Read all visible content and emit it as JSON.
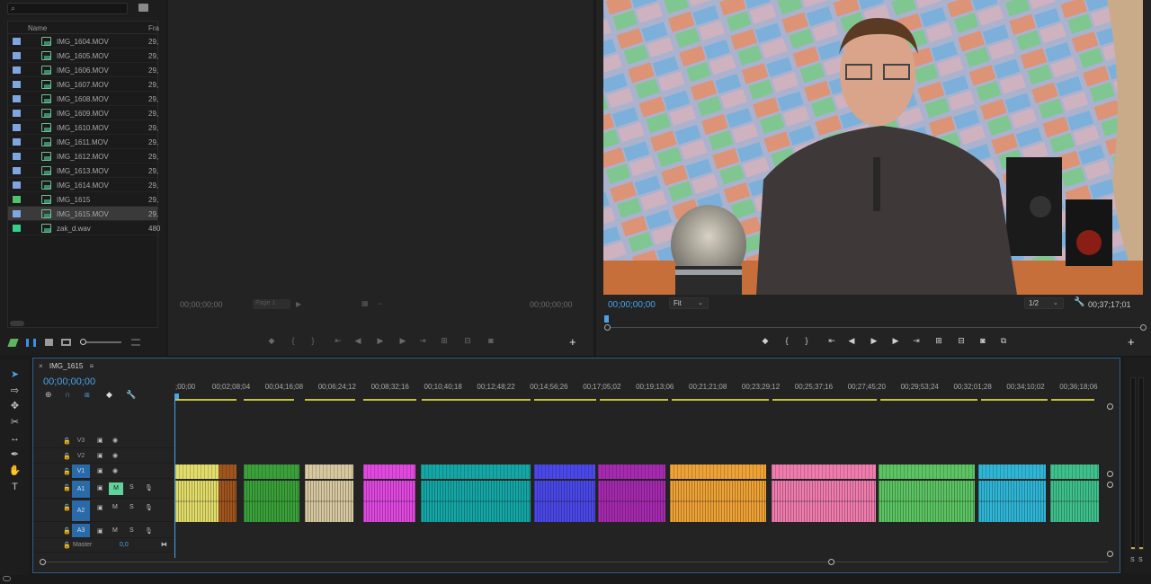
{
  "project": {
    "search_placeholder": "",
    "columns": {
      "name": "Name",
      "frame_rate": "Fra"
    },
    "items": [
      {
        "name": "IMG_1604.MOV",
        "frame_rate": "29,",
        "label_color": "#7fa6e0",
        "icon": "video-clip-icon",
        "selected": false
      },
      {
        "name": "IMG_1605.MOV",
        "frame_rate": "29,",
        "label_color": "#7fa6e0",
        "icon": "video-clip-icon",
        "selected": false
      },
      {
        "name": "IMG_1606.MOV",
        "frame_rate": "29,",
        "label_color": "#7fa6e0",
        "icon": "video-clip-icon",
        "selected": false
      },
      {
        "name": "IMG_1607.MOV",
        "frame_rate": "29,",
        "label_color": "#7fa6e0",
        "icon": "video-clip-icon",
        "selected": false
      },
      {
        "name": "IMG_1608.MOV",
        "frame_rate": "29,",
        "label_color": "#7fa6e0",
        "icon": "video-clip-icon",
        "selected": false
      },
      {
        "name": "IMG_1609.MOV",
        "frame_rate": "29,",
        "label_color": "#7fa6e0",
        "icon": "video-clip-icon",
        "selected": false
      },
      {
        "name": "IMG_1610.MOV",
        "frame_rate": "29,",
        "label_color": "#7fa6e0",
        "icon": "video-clip-icon",
        "selected": false
      },
      {
        "name": "IMG_1611.MOV",
        "frame_rate": "29,",
        "label_color": "#7fa6e0",
        "icon": "video-clip-icon",
        "selected": false
      },
      {
        "name": "IMG_1612.MOV",
        "frame_rate": "29,",
        "label_color": "#7fa6e0",
        "icon": "video-clip-icon",
        "selected": false
      },
      {
        "name": "IMG_1613.MOV",
        "frame_rate": "29,",
        "label_color": "#7fa6e0",
        "icon": "video-clip-icon",
        "selected": false
      },
      {
        "name": "IMG_1614.MOV",
        "frame_rate": "29,",
        "label_color": "#7fa6e0",
        "icon": "video-clip-icon",
        "selected": false
      },
      {
        "name": "IMG_1615",
        "frame_rate": "29,",
        "label_color": "#4fc36a",
        "icon": "sequence-icon",
        "selected": false
      },
      {
        "name": "IMG_1615.MOV",
        "frame_rate": "29,",
        "label_color": "#7fa6e0",
        "icon": "video-clip-icon",
        "selected": true
      },
      {
        "name": "zak_d.wav",
        "frame_rate": "480",
        "label_color": "#33d18c",
        "icon": "audio-clip-icon",
        "selected": false
      }
    ]
  },
  "source": {
    "timecode_in": "00;00;00;00",
    "timecode_out": "00;00;00;00",
    "page_select": "Page 1"
  },
  "program": {
    "timecode": "00;00;00;00",
    "zoom": "Fit",
    "resolution": "1/2",
    "duration": "00;37;17;01"
  },
  "timeline": {
    "sequence_name": "IMG_1615",
    "timecode": "00;00;00;00",
    "ruler": [
      ";00;00",
      "00;02;08;04",
      "00;04;16;08",
      "00;06;24;12",
      "00;08;32;16",
      "00;10;40;18",
      "00;12;48;22",
      "00;14;56;26",
      "00;17;05;02",
      "00;19;13;06",
      "00;21;21;08",
      "00;23;29;12",
      "00;25;37;16",
      "00;27;45;20",
      "00;29;53;24",
      "00;32;01;28",
      "00;34;10;02",
      "00;36;18;06"
    ],
    "video_tracks": [
      "V3",
      "V2",
      "V1"
    ],
    "audio_tracks": [
      "A1",
      "A2",
      "A3"
    ],
    "track_labels": {
      "mute": "M",
      "solo": "S"
    },
    "master": {
      "label": "Master",
      "value": "0,0"
    },
    "clip_colors": [
      "#e2dc6a",
      "#a0551e",
      "#3aa13a",
      "#d8c8a0",
      "#e048e0",
      "#15a6a6",
      "#4a48e8",
      "#a62ab0",
      "#eea236",
      "#f07cae",
      "#5cc462",
      "#2fb6d6",
      "#3ec08c"
    ]
  },
  "meters": {
    "solo_left": "S",
    "solo_right": "S"
  }
}
